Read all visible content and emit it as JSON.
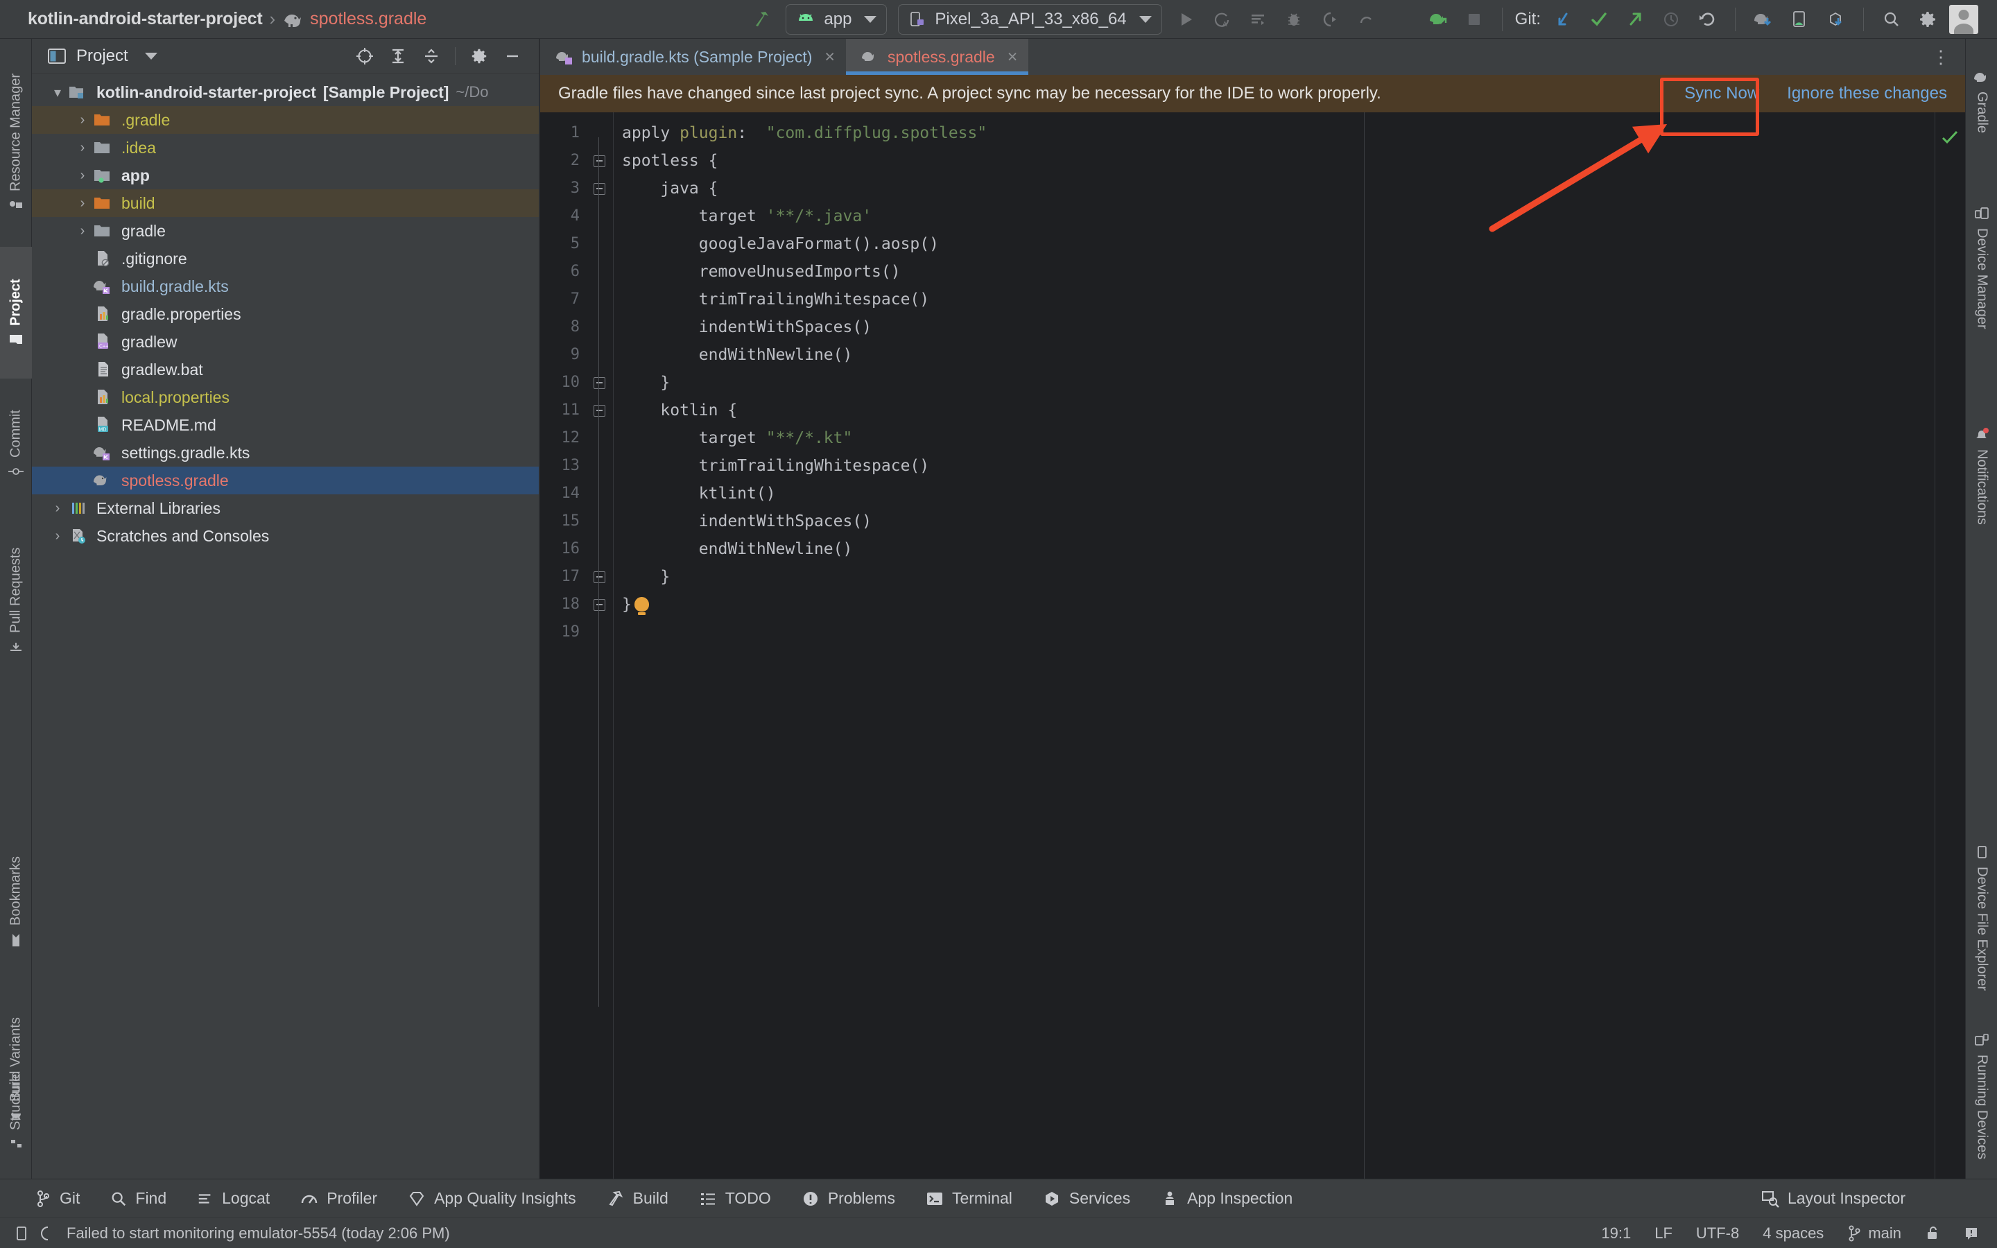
{
  "titlebar": {
    "project_name": "kotlin-android-starter-project",
    "separator": "›",
    "current_file": "spotless.gradle",
    "run_config": "app",
    "device": "Pixel_3a_API_33_x86_64",
    "git_label": "Git:",
    "icons": [
      "build-hammer-icon",
      "run-icon",
      "run-coverage-icon",
      "run-with-profiler-icon",
      "debug-icon",
      "attach-debugger-icon",
      "more-run-icon",
      "run-dropdown-caret",
      "make-project-icon",
      "stop-icon",
      "git-update-icon",
      "git-commit-icon",
      "git-push-icon",
      "git-history-icon",
      "git-rollback-icon",
      "gradle-sync-icon",
      "device-android-icon",
      "sdk-download-icon",
      "search-icon",
      "settings-gear-icon",
      "user-avatar"
    ]
  },
  "left_rail": {
    "tabs_top": [
      {
        "label": "Resource Manager",
        "icon": "resource-manager-icon",
        "active": false
      },
      {
        "label": "Project",
        "icon": "project-folder-icon",
        "active": true
      },
      {
        "label": "Commit",
        "icon": "commit-icon",
        "active": false
      },
      {
        "label": "Pull Requests",
        "icon": "pull-request-icon",
        "active": false
      }
    ],
    "tabs_bottom": [
      {
        "label": "Bookmarks",
        "icon": "bookmark-icon"
      },
      {
        "label": "Build Variants",
        "icon": "build-variants-icon"
      },
      {
        "label": "Structure",
        "icon": "structure-icon"
      }
    ]
  },
  "right_rail": {
    "tabs_top": [
      {
        "label": "Gradle",
        "icon": "gradle-elephant-icon"
      },
      {
        "label": "Device Manager",
        "icon": "device-manager-icon"
      },
      {
        "label": "Notifications",
        "icon": "notifications-bell-icon"
      }
    ],
    "tabs_bottom": [
      {
        "label": "Device File Explorer",
        "icon": "device-file-explorer-icon"
      },
      {
        "label": "Running Devices",
        "icon": "running-devices-icon"
      }
    ]
  },
  "project_panel": {
    "title": "Project",
    "tools": [
      "select-opened-file-icon",
      "expand-all-icon",
      "collapse-all-icon",
      "settings-gear-icon",
      "hide-panel-icon"
    ],
    "tree": [
      {
        "indent": 0,
        "arrow": "down",
        "icon": "project-root-folder-icon",
        "label": "kotlin-android-starter-project",
        "suffix_bold": "[Sample Project]",
        "path_hint": "~/Do",
        "bold": true,
        "state": "normal"
      },
      {
        "indent": 1,
        "arrow": "right",
        "icon": "folder-orange-icon",
        "label": ".gradle",
        "state": "ignored",
        "color": "yellow"
      },
      {
        "indent": 1,
        "arrow": "right",
        "icon": "folder-grey-icon",
        "label": ".idea",
        "state": "normal",
        "color": "yellow"
      },
      {
        "indent": 1,
        "arrow": "right",
        "icon": "module-folder-icon",
        "label": "app",
        "state": "normal",
        "bold": true
      },
      {
        "indent": 1,
        "arrow": "right",
        "icon": "folder-orange-icon",
        "label": "build",
        "state": "ignored",
        "color": "yellow"
      },
      {
        "indent": 1,
        "arrow": "right",
        "icon": "folder-grey-icon",
        "label": "gradle",
        "state": "normal"
      },
      {
        "indent": 1,
        "arrow": "none",
        "icon": "gitignore-file-icon",
        "label": ".gitignore",
        "state": "normal"
      },
      {
        "indent": 1,
        "arrow": "none",
        "icon": "gradle-kts-file-icon",
        "label": "build.gradle.kts",
        "state": "normal",
        "color": "blue"
      },
      {
        "indent": 1,
        "arrow": "none",
        "icon": "properties-file-icon",
        "label": "gradle.properties",
        "state": "normal"
      },
      {
        "indent": 1,
        "arrow": "none",
        "icon": "cpp-file-icon",
        "label": "gradlew",
        "state": "normal"
      },
      {
        "indent": 1,
        "arrow": "none",
        "icon": "text-file-icon",
        "label": "gradlew.bat",
        "state": "normal"
      },
      {
        "indent": 1,
        "arrow": "none",
        "icon": "properties-file-icon",
        "label": "local.properties",
        "state": "normal",
        "color": "yellow"
      },
      {
        "indent": 1,
        "arrow": "none",
        "icon": "markdown-file-icon",
        "label": "README.md",
        "state": "normal"
      },
      {
        "indent": 1,
        "arrow": "none",
        "icon": "gradle-kts-file-icon",
        "label": "settings.gradle.kts",
        "state": "normal"
      },
      {
        "indent": 1,
        "arrow": "none",
        "icon": "gradle-file-icon",
        "label": "spotless.gradle",
        "state": "selected",
        "color": "red"
      },
      {
        "indent": 0,
        "arrow": "right",
        "icon": "external-libraries-icon",
        "label": "External Libraries",
        "state": "normal"
      },
      {
        "indent": 0,
        "arrow": "right",
        "icon": "scratches-icon",
        "label": "Scratches and Consoles",
        "state": "normal"
      }
    ]
  },
  "editor": {
    "tabs": [
      {
        "label": "build.gradle.kts (Sample Project)",
        "icon": "gradle-kts-file-icon",
        "active": false,
        "close": "×"
      },
      {
        "label": "spotless.gradle",
        "icon": "gradle-file-icon",
        "active": true,
        "close": "×"
      }
    ],
    "tabs_more_icon": "more-options-icon",
    "notification": {
      "message": "Gradle files have changed since last project sync. A project sync may be necessary for the IDE to work properly.",
      "sync_label": "Sync Now",
      "ignore_label": "Ignore these changes"
    },
    "line_numbers": [
      "1",
      "2",
      "3",
      "4",
      "5",
      "6",
      "7",
      "8",
      "9",
      "10",
      "11",
      "12",
      "13",
      "14",
      "15",
      "16",
      "17",
      "18",
      "19"
    ],
    "code_lines": [
      {
        "n": 1,
        "fold": false,
        "tokens": [
          {
            "t": "apply ",
            "c": "plain"
          },
          {
            "t": "plugin",
            "c": "attr"
          },
          {
            "t": ":  ",
            "c": "plain"
          },
          {
            "t": "\"com.diffplug.spotless\"",
            "c": "string"
          }
        ]
      },
      {
        "n": 2,
        "fold": true,
        "tokens": [
          {
            "t": "spotless {",
            "c": "plain"
          }
        ]
      },
      {
        "n": 3,
        "fold": true,
        "tokens": [
          {
            "t": "    java {",
            "c": "plain"
          }
        ]
      },
      {
        "n": 4,
        "fold": false,
        "tokens": [
          {
            "t": "        target ",
            "c": "plain"
          },
          {
            "t": "'**/*.java'",
            "c": "string"
          }
        ]
      },
      {
        "n": 5,
        "fold": false,
        "tokens": [
          {
            "t": "        googleJavaFormat().aosp()",
            "c": "plain"
          }
        ]
      },
      {
        "n": 6,
        "fold": false,
        "tokens": [
          {
            "t": "        removeUnusedImports()",
            "c": "plain"
          }
        ]
      },
      {
        "n": 7,
        "fold": false,
        "tokens": [
          {
            "t": "        trimTrailingWhitespace()",
            "c": "plain"
          }
        ]
      },
      {
        "n": 8,
        "fold": false,
        "tokens": [
          {
            "t": "        indentWithSpaces()",
            "c": "plain"
          }
        ]
      },
      {
        "n": 9,
        "fold": false,
        "tokens": [
          {
            "t": "        endWithNewline()",
            "c": "plain"
          }
        ]
      },
      {
        "n": 10,
        "fold": true,
        "tokens": [
          {
            "t": "    }",
            "c": "plain"
          }
        ]
      },
      {
        "n": 11,
        "fold": true,
        "tokens": [
          {
            "t": "    kotlin {",
            "c": "plain"
          }
        ]
      },
      {
        "n": 12,
        "fold": false,
        "tokens": [
          {
            "t": "        target ",
            "c": "plain"
          },
          {
            "t": "\"**/*.kt\"",
            "c": "string"
          }
        ]
      },
      {
        "n": 13,
        "fold": false,
        "tokens": [
          {
            "t": "        trimTrailingWhitespace()",
            "c": "plain"
          }
        ]
      },
      {
        "n": 14,
        "fold": false,
        "tokens": [
          {
            "t": "        ktlint()",
            "c": "plain"
          }
        ]
      },
      {
        "n": 15,
        "fold": false,
        "tokens": [
          {
            "t": "        indentWithSpaces()",
            "c": "plain"
          }
        ]
      },
      {
        "n": 16,
        "fold": false,
        "tokens": [
          {
            "t": "        endWithNewline()",
            "c": "plain"
          }
        ]
      },
      {
        "n": 17,
        "fold": true,
        "tokens": [
          {
            "t": "    }",
            "c": "plain"
          }
        ]
      },
      {
        "n": 18,
        "fold": true,
        "tokens": [
          {
            "t": "}",
            "c": "plain"
          },
          {
            "t": "BULB",
            "c": "bulb"
          }
        ]
      },
      {
        "n": 19,
        "fold": false,
        "tokens": []
      }
    ]
  },
  "bottom_toolbar": [
    {
      "label": "Git",
      "icon": "git-branch-icon"
    },
    {
      "label": "Find",
      "icon": "search-icon"
    },
    {
      "label": "Logcat",
      "icon": "logcat-icon"
    },
    {
      "label": "Profiler",
      "icon": "profiler-icon"
    },
    {
      "label": "App Quality Insights",
      "icon": "app-quality-insights-icon"
    },
    {
      "label": "Build",
      "icon": "build-hammer-icon"
    },
    {
      "label": "TODO",
      "icon": "todo-list-icon"
    },
    {
      "label": "Problems",
      "icon": "problems-icon"
    },
    {
      "label": "Terminal",
      "icon": "terminal-icon"
    },
    {
      "label": "Services",
      "icon": "services-icon"
    },
    {
      "label": "App Inspection",
      "icon": "app-inspection-icon"
    }
  ],
  "bottom_right": {
    "layout_inspector": "Layout Inspector",
    "layout_inspector_icon": "layout-inspector-icon"
  },
  "status_bar": {
    "message": "Failed to start monitoring emulator-5554 (today 2:06 PM)",
    "message_icon": "device-icon",
    "spinner_icon": "progress-spinner-icon",
    "caret_position": "19:1",
    "line_separator": "LF",
    "encoding": "UTF-8",
    "indent": "4 spaces",
    "branch": "main",
    "branch_icon": "git-branch-icon",
    "lock_icon": "unlock-icon",
    "notifications_icon": "event-log-icon"
  },
  "annotation": {
    "highlight_target": "Sync Now",
    "box_color": "#f0482a",
    "arrow_color": "#f0482a"
  }
}
